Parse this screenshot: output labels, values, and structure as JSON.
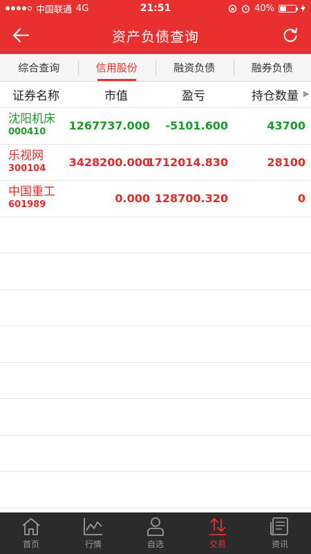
{
  "status": {
    "carrier": "中国联通",
    "network": "4G",
    "time": "21:51",
    "battery": "40%",
    "battery_level": 0.4
  },
  "nav": {
    "title": "资产负债查询"
  },
  "tabs": [
    {
      "label": "综合查询",
      "active": false
    },
    {
      "label": "信用股份",
      "active": true
    },
    {
      "label": "融资负债",
      "active": false
    },
    {
      "label": "融券负债",
      "active": false
    }
  ],
  "table": {
    "headers": [
      "证券名称",
      "市值",
      "盈亏",
      "持仓数量"
    ],
    "rows": [
      {
        "name": "沈阳机床",
        "code": "000410",
        "market_value": "1267737.000",
        "profit_loss": "-5101.600",
        "quantity": "43700",
        "color": "#1a9b2a"
      },
      {
        "name": "乐视网",
        "code": "300104",
        "market_value": "3428200.000",
        "profit_loss": "1712014.830",
        "quantity": "28100",
        "color": "#e12a2a"
      },
      {
        "name": "中国重工",
        "code": "601989",
        "market_value": "0.000",
        "profit_loss": "128700.320",
        "quantity": "0",
        "color": "#e12a2a"
      }
    ]
  },
  "bottom_nav": [
    {
      "label": "首页",
      "icon": "home-icon",
      "active": false
    },
    {
      "label": "行情",
      "icon": "chart-icon",
      "active": false
    },
    {
      "label": "自选",
      "icon": "person-icon",
      "active": false
    },
    {
      "label": "交易",
      "icon": "trade-icon",
      "active": true
    },
    {
      "label": "资讯",
      "icon": "news-icon",
      "active": false
    }
  ],
  "colors": {
    "accent": "#e8312f",
    "gain": "#e12a2a",
    "loss": "#1a9b2a",
    "tabbar": "#2b2b2b"
  }
}
